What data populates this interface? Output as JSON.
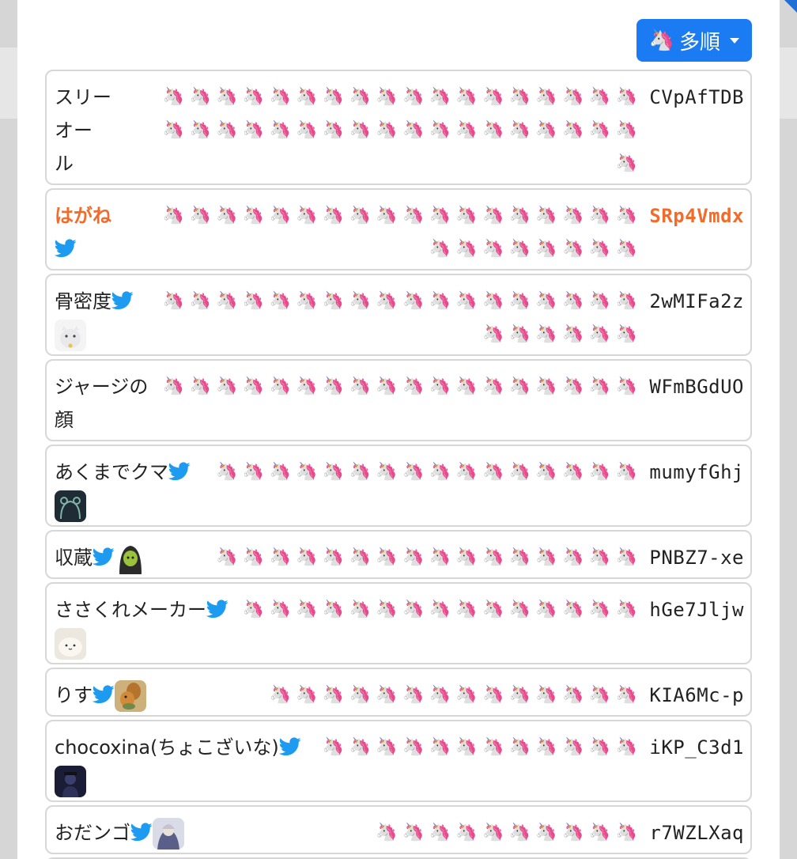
{
  "sort_button": {
    "icon": "unicorn-icon",
    "emoji": "🦄",
    "label": "多順"
  },
  "colors": {
    "accent": "#1a7bf2",
    "highlight": "#f26b2a",
    "twitter": "#1d9bf0"
  },
  "rows": [
    {
      "name_lines": [
        "スリー",
        "オー",
        "ル"
      ],
      "twitter": false,
      "avatar": null,
      "unicorns": 37,
      "unicorn": "🦄",
      "code": "CVpAfTDB",
      "highlight": false
    },
    {
      "name_lines": [
        "はがね",
        ""
      ],
      "twitter": true,
      "twitter_line": 1,
      "avatar": null,
      "unicorns": 26,
      "unicorn": "🦄",
      "code": "SRp4Vmdx",
      "highlight": true
    },
    {
      "name_lines": [
        "骨密度",
        ""
      ],
      "twitter": true,
      "twitter_line": 0,
      "avatar": "cat-plush",
      "avatar_line": 1,
      "unicorns": 24,
      "unicorn": "🦄",
      "code": "2wMIFa2z",
      "highlight": false
    },
    {
      "name_lines": [
        "ジャージの",
        "顔"
      ],
      "twitter": false,
      "avatar": null,
      "unicorns": 18,
      "unicorn": "🦄",
      "code": "WFmBGdUO",
      "highlight": false
    },
    {
      "name_lines": [
        "あくまでクマ",
        ""
      ],
      "twitter": true,
      "twitter_line": 0,
      "avatar": "dark-bear",
      "avatar_line": 1,
      "unicorns": 16,
      "unicorn": "🦄",
      "code": "mumyfGhj",
      "highlight": false
    },
    {
      "name_lines": [
        "収蔵"
      ],
      "twitter": true,
      "twitter_line": 0,
      "avatar": "hooded-figure",
      "avatar_line": 0,
      "unicorns": 16,
      "unicorn": "🦄",
      "code": "PNBZ7-xe",
      "highlight": false
    },
    {
      "name_lines": [
        "ささくれメーカー",
        ""
      ],
      "twitter": true,
      "twitter_line": 0,
      "avatar": "white-blob",
      "avatar_line": 1,
      "unicorns": 15,
      "unicorn": "🦄",
      "code": "hGe7Jljw",
      "highlight": false
    },
    {
      "name_lines": [
        "りす"
      ],
      "twitter": true,
      "twitter_line": 0,
      "avatar": "squirrel",
      "avatar_line": 0,
      "unicorns": 14,
      "unicorn": "🦄",
      "code": "KIA6Mc-p",
      "highlight": false
    },
    {
      "name_lines": [
        "chocoxina(ちょこざいな)",
        ""
      ],
      "twitter": true,
      "twitter_line": 0,
      "avatar": "night-figure",
      "avatar_line": 1,
      "unicorns": 12,
      "unicorn": "🦄",
      "code": "iKP_C3d1",
      "highlight": false
    },
    {
      "name_lines": [
        "おだンゴ"
      ],
      "twitter": true,
      "twitter_line": 0,
      "avatar": "anime-figure",
      "avatar_line": 0,
      "unicorns": 10,
      "unicorn": "🦄",
      "code": "r7WZLXaq",
      "highlight": false
    }
  ]
}
